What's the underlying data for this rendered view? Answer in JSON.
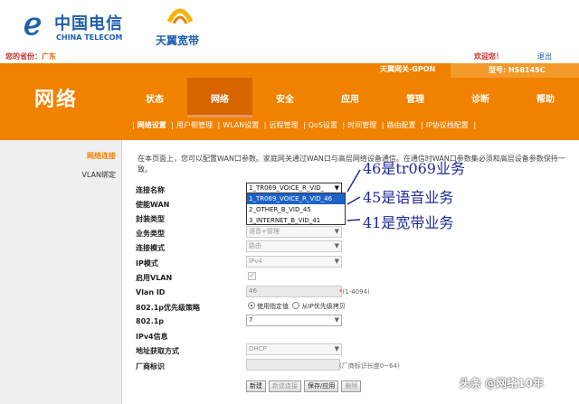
{
  "header": {
    "brand_cn": "中国电信",
    "brand_en": "CHINA TELECOM",
    "brand2": "天翼宽带",
    "province_label": "您的省份：",
    "province_value": "广东",
    "welcome": "欢迎您！",
    "logout": "退出"
  },
  "nav": {
    "section_title": "网络",
    "gateway_name": "天翼网关-GPON",
    "model": "型号: HS8145C",
    "tabs": [
      "状态",
      "网络",
      "安全",
      "应用",
      "管理",
      "诊断",
      "帮助"
    ],
    "active_tab": "网络",
    "subnav": [
      "网络设置",
      "用户侧管理",
      "WLAN设置",
      "远程管理",
      "QoS设置",
      "时间管理",
      "路由配置",
      "IP协议栈配置"
    ]
  },
  "sidebar": {
    "items": [
      "网络连接",
      "VLAN绑定"
    ]
  },
  "main": {
    "intro": "在本页面上，您可以配置WAN口参数。家庭网关通过WAN口与高层网络设备通信。在通信时WAN口参数集必须和高层设备参数保持一致。",
    "fields": {
      "conn_name_label": "连接名称",
      "conn_name_value": "1_TR069_VOICE_R_VID_",
      "enable_wan_label": "使能WAN",
      "encap_label": "封装类型",
      "service_label": "业务类型",
      "service_value": "语音+管理",
      "conn_mode_label": "连接模式",
      "conn_mode_value": "路由",
      "ip_mode_label": "IP模式",
      "ip_mode_value": "IPv4",
      "vlan_enable_label": "启用VLAN",
      "vlan_id_label": "Vlan ID",
      "vlan_id_value": "46",
      "vlan_id_hint": "(1-4094)",
      "priority_policy_label": "802.1p优先级策略",
      "priority_opt1": "使用指定值",
      "priority_opt2": "从IP优先级拷贝",
      "dot1p_label": "802.1p",
      "dot1p_value": "7",
      "ipv4_info_label": "IPv4信息",
      "addr_mode_label": "地址获取方式",
      "addr_mode_value": "DHCP",
      "vendor_label": "厂商标识",
      "vendor_hint": "(厂商标识长度0~64)"
    },
    "dropdown_options": [
      "1_TR069_VOICE_R_VID_46",
      "2_OTHER_B_VID_45",
      "3_INTERNET_B_VID_41"
    ],
    "buttons": [
      "新建",
      "新建连接",
      "保存/应用",
      "删除"
    ]
  },
  "annotations": {
    "a46": "46是tr069业务",
    "a45": "45是语音业务",
    "a41": "41是宽带业务"
  },
  "watermark": "头条 @网络10年",
  "colors": {
    "nav_orange": "#f08200",
    "active_tab": "#d86400",
    "brand_blue": "#1f5fae",
    "annotation_ink": "#1e2a9c",
    "dropdown_selected": "#1e62c8"
  }
}
